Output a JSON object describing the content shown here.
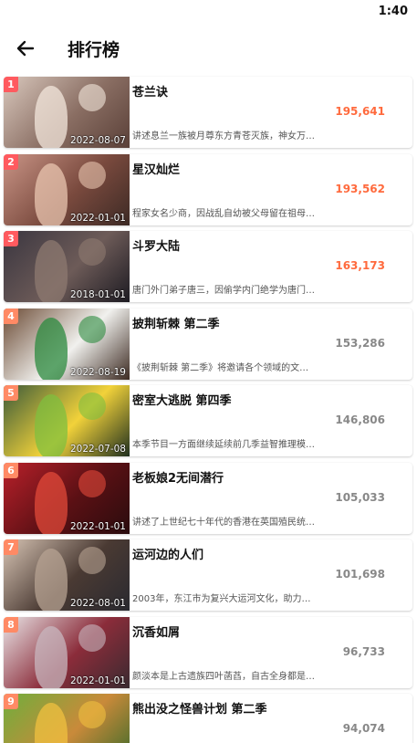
{
  "status_bar": {
    "time": "1:40"
  },
  "header": {
    "title": "排行榜",
    "back_icon": "arrow-left-icon"
  },
  "colors": {
    "top_rank": "#ff5a5f",
    "other_rank": "#ff8a65",
    "top_views": "#ff6a3d",
    "other_views": "#888888"
  },
  "items": [
    {
      "rank": "1",
      "title": "苍兰诀",
      "date": "2022-08-07",
      "views": "195,641",
      "desc": "讲述息兰一族被月尊东方青苍灭族，神女万…",
      "top": true,
      "poster_colors": [
        "#d9c8bd",
        "#8a6e63",
        "#f3e7dc",
        "#5a4038"
      ]
    },
    {
      "rank": "2",
      "title": "星汉灿烂",
      "date": "2022-01-01",
      "views": "193,562",
      "desc": "程家女名少商，因战乱自幼被父母留在祖母…",
      "top": true,
      "poster_colors": [
        "#c99486",
        "#7a4a3e",
        "#e9c6b0",
        "#3d2a25"
      ]
    },
    {
      "rank": "3",
      "title": "斗罗大陆",
      "date": "2018-01-01",
      "views": "163,173",
      "desc": "唐门外门弟子唐三，因偷学内门绝学为唐门…",
      "top": true,
      "poster_colors": [
        "#3a3640",
        "#6d5b58",
        "#8e7a70",
        "#1d1b22"
      ]
    },
    {
      "rank": "4",
      "title": "披荆斩棘 第二季",
      "date": "2022-08-19",
      "views": "153,286",
      "desc": "《披荆斩棘 第二季》将邀请各个领域的文…",
      "top": false,
      "poster_colors": [
        "#6b4a34",
        "#f1f1ee",
        "#2b8a3e",
        "#3d2b22"
      ]
    },
    {
      "rank": "5",
      "title": "密室大逃脱 第四季",
      "date": "2022-07-08",
      "views": "146,806",
      "desc": "本季节目一方面继续延续前几季益智推理模…",
      "top": false,
      "poster_colors": [
        "#3b5a3a",
        "#f2d23a",
        "#7fbf3f",
        "#20301f"
      ]
    },
    {
      "rank": "6",
      "title": "老板娘2无间潜行",
      "date": "2022-01-01",
      "views": "105,033",
      "desc": "讲述了上世纪七十年代的香港在英国殖民统…",
      "top": false,
      "poster_colors": [
        "#b8202a",
        "#5a1014",
        "#e24a3a",
        "#2a0c0e"
      ]
    },
    {
      "rank": "7",
      "title": "运河边的人们",
      "date": "2022-08-01",
      "views": "101,698",
      "desc": "2003年，东江市为复兴大运河文化，助力…",
      "top": false,
      "poster_colors": [
        "#d7c4b4",
        "#4a3a33",
        "#b7a393",
        "#2a2a30"
      ]
    },
    {
      "rank": "8",
      "title": "沉香如屑",
      "date": "2022-01-01",
      "views": "96,733",
      "desc": "颜淡本是上古遗族四叶菡萏，自古全身都是…",
      "top": false,
      "poster_colors": [
        "#e9e4e6",
        "#8b2c3a",
        "#c8b7bf",
        "#3a2a30"
      ]
    },
    {
      "rank": "9",
      "title": "熊出没之怪兽计划 第二季",
      "date": "",
      "views": "94,074",
      "desc": "",
      "top": false,
      "poster_colors": [
        "#6fae3c",
        "#c98a3a",
        "#f0c040",
        "#3a6a2a"
      ]
    }
  ]
}
